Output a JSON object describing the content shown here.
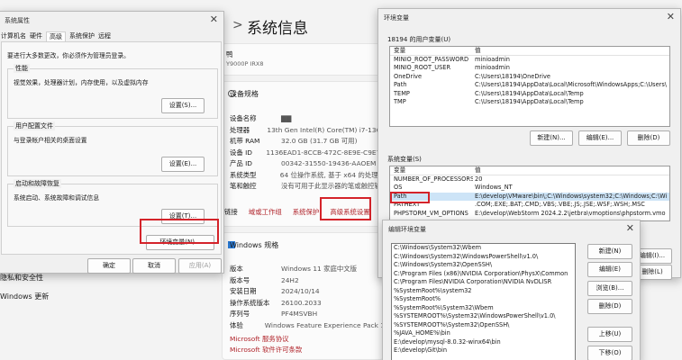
{
  "settings": {
    "breadcrumb_arrow": ">",
    "title": "系统信息",
    "device_name_partial": "鸭",
    "model_partial": "Y9000P IRX8",
    "spec_title": "设备规格",
    "specs": [
      {
        "k": "设备名称",
        "v": "▇▇"
      },
      {
        "k": "处理器",
        "v": "13th Gen Intel(R) Core(TM) i7-1365"
      },
      {
        "k": "机带 RAM",
        "v": "32.0 GB (31.7 GB 可用)"
      },
      {
        "k": "设备 ID",
        "v": "1136EAD1-8CCB-472C-8E9E-C9E75"
      },
      {
        "k": "产品 ID",
        "v": "00342-31550-19436-AAOEM"
      },
      {
        "k": "系统类型",
        "v": "64 位操作系统, 基于 x64 的处理器"
      },
      {
        "k": "笔和触控",
        "v": "没有可用于此显示器的笔或触控输"
      }
    ],
    "links": [
      "链接",
      "域或工作组",
      "系统保护",
      "高级系统设置"
    ],
    "win_spec_title": "Windows 规格",
    "win_specs": [
      {
        "k": "版本",
        "v": "Windows 11 家庭中文版"
      },
      {
        "k": "版本号",
        "v": "24H2"
      },
      {
        "k": "安装日期",
        "v": "2024/10/14"
      },
      {
        "k": "操作系统版本",
        "v": "26100.2033"
      },
      {
        "k": "序列号",
        "v": "PF4MSVBH"
      },
      {
        "k": "体验",
        "v": "Windows Feature Experience Pack 1"
      }
    ],
    "ms_links": [
      "Microsoft 服务协议",
      "Microsoft 软件许可条款"
    ],
    "left_nav": [
      "隐私和安全性",
      "Windows 更新"
    ]
  },
  "sysprops": {
    "title": "系统属性",
    "tabs": [
      "计算机名",
      "硬件",
      "高级",
      "系统保护",
      "远程"
    ],
    "admin_note": "要进行大多数更改，你必须作为管理员登录。",
    "perf_label": "性能",
    "perf_desc": "视觉效果，处理器计划，内存使用，以及虚拟内存",
    "profile_label": "用户配置文件",
    "profile_desc": "与登录帐户相关的桌面设置",
    "startup_label": "启动和故障恢复",
    "startup_desc": "系统启动、系统故障和调试信息",
    "settings_btn": "设置(S)...",
    "settings_btn2": "设置(E)...",
    "settings_btn3": "设置(T)...",
    "env_btn": "环境变量(N)...",
    "ok": "确定",
    "cancel": "取消",
    "apply": "应用(A)"
  },
  "envvars": {
    "title": "环境变量",
    "user_label": "18194 的用户变量(U)",
    "col_var": "变量",
    "col_val": "值",
    "user_vars": [
      {
        "k": "MINIO_ROOT_PASSWORD",
        "v": "minioadmin"
      },
      {
        "k": "MINIO_ROOT_USER",
        "v": "minioadmin"
      },
      {
        "k": "OneDrive",
        "v": "C:\\Users\\18194\\OneDrive"
      },
      {
        "k": "Path",
        "v": "C:\\Users\\18194\\AppData\\Local\\Microsoft\\WindowsApps;C:\\Users\\"
      },
      {
        "k": "TEMP",
        "v": "C:\\Users\\18194\\AppData\\Local\\Temp"
      },
      {
        "k": "TMP",
        "v": "C:\\Users\\18194\\AppData\\Local\\Temp"
      }
    ],
    "new_btn": "新建(N)...",
    "edit_btn": "编辑(E)...",
    "del_btn": "删除(D)",
    "sys_label": "系统变量(S)",
    "sys_vars": [
      {
        "k": "NUMBER_OF_PROCESSORS",
        "v": "20"
      },
      {
        "k": "OS",
        "v": "Windows_NT"
      },
      {
        "k": "Path",
        "v": "E:\\develop\\VMware\\bin\\;C:\\Windows\\system32;C:\\Windows;C:\\Wi"
      },
      {
        "k": "PATHEXT",
        "v": ".COM;.EXE;.BAT;.CMD;.VBS;.VBE;.JS;.JSE;.WSF;.WSH;.MSC"
      },
      {
        "k": "PHPSTORM_VM_OPTIONS",
        "v": "E:\\develop\\WebStorm 2024.2.2\\jetbra\\vmoptions\\phpstorm.vmo"
      }
    ],
    "sys_btn1": "编辑(I)...",
    "sys_btn2": "删除(L)"
  },
  "editenv": {
    "title": "编辑环境变量",
    "paths": [
      "C:\\Windows\\System32\\Wbem",
      "C:\\Windows\\System32\\WindowsPowerShell\\v1.0\\",
      "C:\\Windows\\System32\\OpenSSH\\",
      "C:\\Program Files (x86)\\NVIDIA Corporation\\PhysX\\Common",
      "C:\\Program Files\\NVIDIA Corporation\\NVIDIA NvDLISR",
      "%SystemRoot%\\system32",
      "%SystemRoot%",
      "%SystemRoot%\\System32\\Wbem",
      "%SYSTEMROOT%\\System32\\WindowsPowerShell\\v1.0\\",
      "%SYSTEMROOT%\\System32\\OpenSSH\\",
      "%JAVA_HOME%\\bin",
      "E:\\develop\\mysql-8.0.32-winx64\\bin",
      "E:\\develop\\Git\\bin"
    ],
    "buttons": [
      "新建(N)",
      "编辑(E)",
      "浏览(B)...",
      "删除(D)",
      "上移(U)",
      "下移(O)"
    ]
  }
}
